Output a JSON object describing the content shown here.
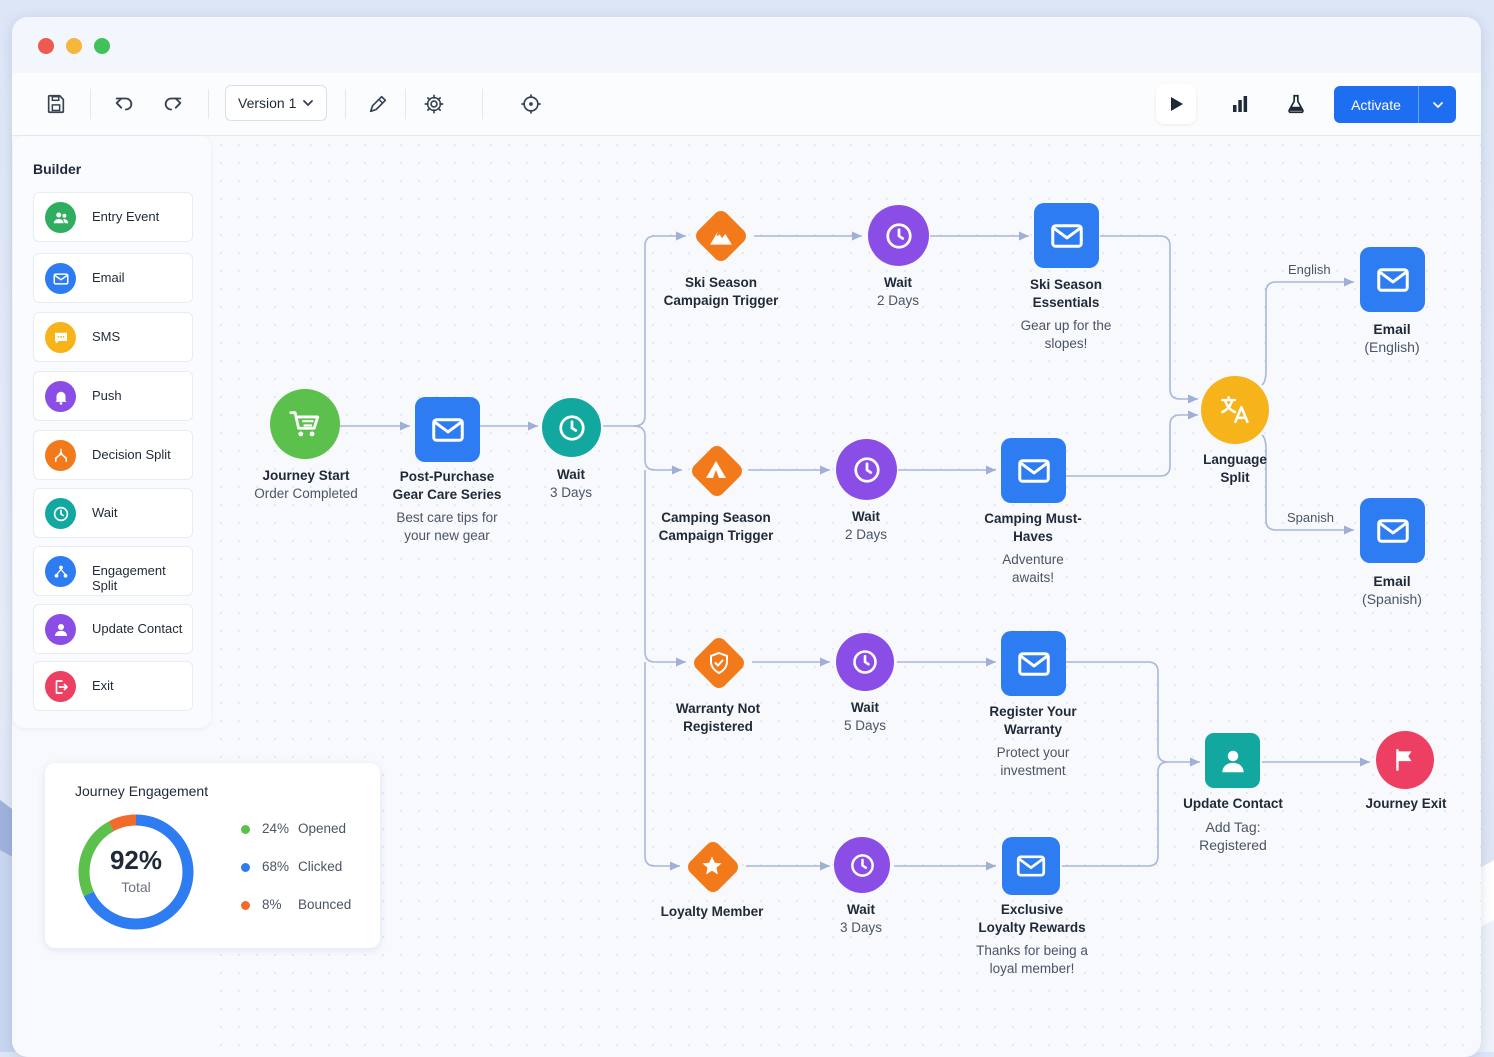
{
  "toolbar": {
    "version": "Version 1",
    "activate": "Activate"
  },
  "sidebar": {
    "title": "Builder",
    "items": [
      {
        "label": "Entry Event",
        "icon": "users-icon",
        "color": "#2fae5f"
      },
      {
        "label": "Email",
        "icon": "mail-icon",
        "color": "#2d7cf2"
      },
      {
        "label": "SMS",
        "icon": "chat-icon",
        "color": "#f7b31a"
      },
      {
        "label": "Push",
        "icon": "bell-icon",
        "color": "#8a4de6"
      },
      {
        "label": "Decision Split",
        "icon": "split-icon",
        "color": "#f27a1a"
      },
      {
        "label": "Wait",
        "icon": "clock-icon",
        "color": "#12a8a0"
      },
      {
        "label": "Engagement Split",
        "icon": "engagement-icon",
        "color": "#2d7cf2"
      },
      {
        "label": "Update Contact",
        "icon": "person-icon",
        "color": "#8a4de6"
      },
      {
        "label": "Exit",
        "icon": "exit-icon",
        "color": "#ec3f62"
      }
    ]
  },
  "flow": {
    "start": {
      "title": "Journey Start",
      "sub": "Order Completed"
    },
    "post_purchase": {
      "title": "Post-Purchase Gear Care Series",
      "desc": "Best care tips for your new gear"
    },
    "wait_main": {
      "title": "Wait",
      "sub": "3 Days"
    },
    "ski_trigger": {
      "title": "Ski Season Campaign Trigger"
    },
    "ski_wait": {
      "title": "Wait",
      "sub": "2 Days"
    },
    "ski_email": {
      "title": "Ski Season Essentials",
      "desc": "Gear up for the slopes!"
    },
    "camp_trigger": {
      "title": "Camping Season Campaign Trigger"
    },
    "camp_wait": {
      "title": "Wait",
      "sub": "2 Days"
    },
    "camp_email": {
      "title": "Camping Must-Haves",
      "desc": "Adventure awaits!"
    },
    "warranty_trigger": {
      "title": "Warranty Not Registered"
    },
    "warranty_wait": {
      "title": "Wait",
      "sub": "5 Days"
    },
    "warranty_email": {
      "title": "Register Your Warranty",
      "desc": "Protect your investment"
    },
    "loyalty_trigger": {
      "title": "Loyalty Member"
    },
    "loyalty_wait": {
      "title": "Wait",
      "sub": "3 Days"
    },
    "loyalty_email": {
      "title": "Exclusive Loyalty Rewards",
      "desc": "Thanks for being a loyal member!"
    },
    "language_split": {
      "title": "Language Split",
      "branch_en": "English",
      "branch_es": "Spanish"
    },
    "email_en": {
      "title": "Email",
      "sub": "(English)"
    },
    "email_es": {
      "title": "Email",
      "sub": "(Spanish)"
    },
    "update_contact": {
      "title": "Update Contact",
      "desc": "Add Tag: Registered"
    },
    "journey_exit": {
      "title": "Journey Exit"
    }
  },
  "engagement": {
    "title": "Journey Engagement",
    "total_value": "92%",
    "total_label": "Total",
    "total_fraction": 0.92,
    "legend": [
      {
        "pct": "24%",
        "name": "Opened",
        "color": "#5cc04c",
        "value": 24
      },
      {
        "pct": "68%",
        "name": "Clicked",
        "color": "#2d7cf2",
        "value": 68
      },
      {
        "pct": "8%",
        "name": "Bounced",
        "color": "#f26b2a",
        "value": 8
      }
    ]
  },
  "colors": {
    "accent": "#1d6ef0",
    "email": "#2d7cf2",
    "wait": "#8a4de6",
    "trigger": "#f27a1a",
    "start": "#5cc04c",
    "teal": "#12a8a0",
    "language": "#f7b31a",
    "exit": "#ec3f62"
  }
}
